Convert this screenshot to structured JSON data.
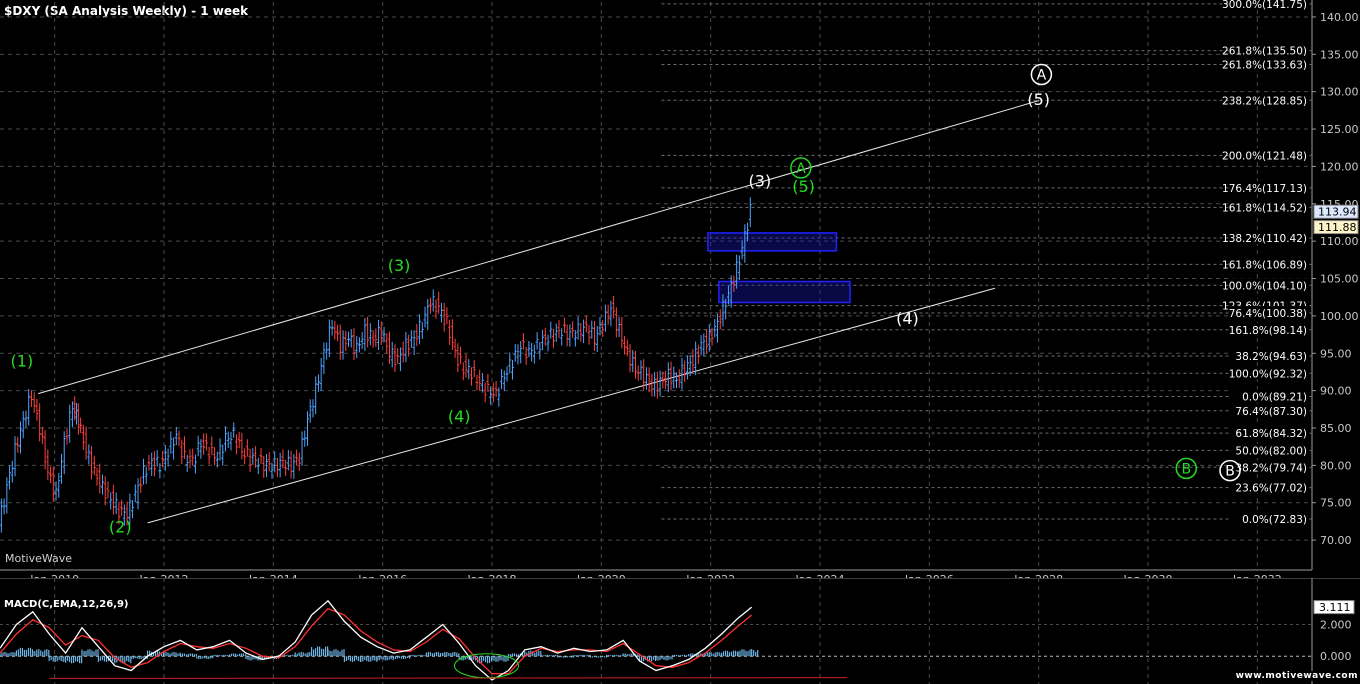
{
  "chart_title": "$DXY (SA Analysis Weekly) - 1 week",
  "watermark": "MotiveWave",
  "footer_url": "www.motivewave.com",
  "colors": {
    "background": "#000000",
    "grid": "#4a4a4a",
    "axis_text": "#c8c8c8",
    "wave_green": "#22dd22",
    "wave_white": "#ffffff",
    "candle_up": "#4fa3ff",
    "candle_down": "#ff4040",
    "box": "#1f22ff",
    "macd_line": "#ffffff",
    "macd_signal": "#ff3030",
    "macd_hist": "#6fb6e6"
  },
  "chart_data": [
    {
      "type": "line",
      "name": "price",
      "ylim": [
        66,
        142
      ],
      "xlim": [
        2009.0,
        2033.0
      ],
      "y_ticks": [
        70,
        75,
        80,
        85,
        90,
        95,
        100,
        105,
        110,
        115,
        120,
        125,
        130,
        135,
        140
      ],
      "y_tick_labels": [
        "70.00",
        "75.00",
        "80.00",
        "85.00",
        "90.00",
        "95.00",
        "100.00",
        "105.00",
        "110.00",
        "115.00",
        "120.00",
        "125.00",
        "130.00",
        "135.00",
        "140.00"
      ],
      "x_ticks": [
        2010,
        2012,
        2014,
        2016,
        2018,
        2020,
        2022,
        2024,
        2026,
        2028,
        2030,
        2032
      ],
      "x_tick_labels": [
        "Jan-2010",
        "Jan-2012",
        "Jan-2014",
        "Jan-2016",
        "Jan-2018",
        "Jan-2020",
        "Jan-2022",
        "Jan-2024",
        "Jan-2026",
        "Jan-2028",
        "Jan-2030",
        "Jan-2032"
      ],
      "x": [
        2009.0,
        2009.15,
        2009.3,
        2009.45,
        2009.6,
        2009.75,
        2009.9,
        2010.05,
        2010.2,
        2010.35,
        2010.45,
        2010.6,
        2010.75,
        2010.9,
        2011.05,
        2011.2,
        2011.35,
        2011.5,
        2011.65,
        2011.8,
        2011.95,
        2012.1,
        2012.25,
        2012.4,
        2012.55,
        2012.7,
        2012.85,
        2013.0,
        2013.15,
        2013.3,
        2013.45,
        2013.6,
        2013.75,
        2013.9,
        2014.05,
        2014.2,
        2014.35,
        2014.5,
        2014.65,
        2014.8,
        2014.95,
        2015.1,
        2015.25,
        2015.4,
        2015.55,
        2015.7,
        2015.85,
        2016.0,
        2016.15,
        2016.3,
        2016.45,
        2016.6,
        2016.75,
        2016.9,
        2017.05,
        2017.2,
        2017.35,
        2017.5,
        2017.65,
        2017.8,
        2017.95,
        2018.1,
        2018.25,
        2018.4,
        2018.55,
        2018.7,
        2018.85,
        2019.0,
        2019.15,
        2019.3,
        2019.45,
        2019.6,
        2019.75,
        2019.9,
        2020.05,
        2020.2,
        2020.35,
        2020.5,
        2020.65,
        2020.8,
        2020.95,
        2021.1,
        2021.25,
        2021.4,
        2021.55,
        2021.7,
        2021.85,
        2022.0,
        2022.15,
        2022.3,
        2022.45,
        2022.6,
        2022.75
      ],
      "y": [
        72,
        77,
        82,
        86,
        89.5,
        85,
        79,
        76,
        83,
        88,
        86,
        82,
        79,
        77,
        75.5,
        74,
        73.5,
        76,
        79,
        80.5,
        80,
        82,
        84,
        81,
        80.5,
        83,
        82,
        81,
        83.5,
        84,
        82,
        81,
        80.5,
        80,
        80,
        80.5,
        80,
        81,
        86,
        90,
        95,
        99,
        96,
        97,
        95.5,
        98,
        97,
        98,
        95,
        94,
        96,
        97,
        99,
        102,
        101,
        99,
        95,
        93,
        92.5,
        91,
        90,
        89.5,
        92,
        94,
        96,
        95,
        96,
        97,
        97.5,
        98,
        97.5,
        98,
        98.5,
        97,
        99,
        101,
        98,
        95,
        93,
        92,
        90.5,
        91,
        92,
        91.5,
        93,
        94,
        96,
        97,
        99,
        102,
        105,
        109,
        114
      ]
    },
    {
      "type": "line",
      "name": "MACD(C,EMA,12,26,9)",
      "ylim": [
        -1.5,
        3.8
      ],
      "y_ticks": [
        0,
        2
      ],
      "y_tick_labels": [
        "0.000",
        "2.000"
      ],
      "last_value": "3.111",
      "x": [
        2009.0,
        2009.3,
        2009.6,
        2009.9,
        2010.2,
        2010.5,
        2010.8,
        2011.1,
        2011.4,
        2011.7,
        2012.0,
        2012.3,
        2012.6,
        2012.9,
        2013.2,
        2013.5,
        2013.8,
        2014.1,
        2014.4,
        2014.7,
        2015.0,
        2015.3,
        2015.6,
        2015.9,
        2016.2,
        2016.5,
        2016.8,
        2017.1,
        2017.4,
        2017.7,
        2018.0,
        2018.3,
        2018.6,
        2018.9,
        2019.2,
        2019.5,
        2019.8,
        2020.1,
        2020.4,
        2020.7,
        2021.0,
        2021.3,
        2021.6,
        2021.9,
        2022.2,
        2022.5,
        2022.75
      ],
      "macd": [
        0.5,
        2.0,
        2.8,
        1.4,
        0.2,
        1.8,
        0.6,
        -0.6,
        -0.9,
        0.0,
        0.6,
        1.0,
        0.4,
        0.6,
        1.0,
        0.2,
        -0.2,
        0.0,
        0.9,
        2.6,
        3.5,
        2.2,
        1.2,
        0.6,
        0.2,
        0.4,
        1.2,
        2.0,
        0.8,
        -0.6,
        -1.5,
        -0.9,
        0.4,
        0.6,
        0.2,
        0.5,
        0.3,
        0.4,
        1.0,
        -0.3,
        -0.9,
        -0.6,
        -0.2,
        0.5,
        1.4,
        2.4,
        3.1
      ],
      "signal": [
        0.2,
        1.4,
        2.3,
        1.8,
        0.7,
        1.3,
        1.0,
        -0.1,
        -0.7,
        -0.4,
        0.3,
        0.8,
        0.6,
        0.5,
        0.8,
        0.5,
        0.0,
        -0.1,
        0.6,
        1.9,
        3.0,
        2.6,
        1.6,
        0.9,
        0.4,
        0.3,
        0.9,
        1.7,
        1.1,
        -0.1,
        -1.1,
        -1.1,
        0.0,
        0.5,
        0.3,
        0.4,
        0.4,
        0.3,
        0.8,
        0.1,
        -0.6,
        -0.7,
        -0.4,
        0.2,
        1.0,
        1.9,
        2.6
      ]
    }
  ],
  "fib_levels": [
    {
      "label": "300.0%(141.75)",
      "value": 141.75
    },
    {
      "label": "261.8%(135.50)",
      "value": 135.5
    },
    {
      "label": "261.8%(133.63)",
      "value": 133.63
    },
    {
      "label": "238.2%(128.85)",
      "value": 128.85
    },
    {
      "label": "200.0%(121.48)",
      "value": 121.48
    },
    {
      "label": "176.4%(117.13)",
      "value": 117.13
    },
    {
      "label": "161.8%(114.52)",
      "value": 114.52
    },
    {
      "label": "138.2%(110.42)",
      "value": 110.42
    },
    {
      "label": "161.8%(106.89)",
      "value": 106.89
    },
    {
      "label": "100.0%(104.10)",
      "value": 104.1
    },
    {
      "label": "123.6%(101.37)",
      "value": 101.37
    },
    {
      "label": "76.4%(100.38)",
      "value": 100.38
    },
    {
      "label": "161.8%(98.14)",
      "value": 98.14
    },
    {
      "label": "38.2%(94.63)",
      "value": 94.63
    },
    {
      "label": "100.0%(92.32)",
      "value": 92.32
    },
    {
      "label": "0.0%(89.21)",
      "value": 89.21
    },
    {
      "label": "76.4%(87.30)",
      "value": 87.3
    },
    {
      "label": "61.8%(84.32)",
      "value": 84.32
    },
    {
      "label": "50.0%(82.00)",
      "value": 82.0
    },
    {
      "label": "38.2%(79.74)",
      "value": 79.74
    },
    {
      "label": "23.6%(77.02)",
      "value": 77.02
    },
    {
      "label": "0.0%(72.83)",
      "value": 72.83
    }
  ],
  "price_tags": [
    {
      "label": "113.94",
      "value": 113.94,
      "bg": "#dce8ff"
    },
    {
      "label": "111.88",
      "value": 111.88,
      "bg": "#fff4c8"
    }
  ],
  "wave_labels": [
    {
      "text": "(1)",
      "x": 2009.4,
      "y": 93.2,
      "color": "green"
    },
    {
      "text": "(2)",
      "x": 2011.2,
      "y": 71.0,
      "color": "green"
    },
    {
      "text": "(3)",
      "x": 2016.3,
      "y": 106.0,
      "color": "green"
    },
    {
      "text": "(4)",
      "x": 2017.4,
      "y": 85.8,
      "color": "green"
    },
    {
      "text": "(5)",
      "x": 2023.7,
      "y": 116.6,
      "color": "green"
    },
    {
      "text": "(3)",
      "x": 2022.9,
      "y": 117.3,
      "color": "white"
    },
    {
      "text": "(4)",
      "x": 2025.6,
      "y": 98.9,
      "color": "white"
    },
    {
      "text": "(5)",
      "x": 2028.0,
      "y": 128.2,
      "color": "white"
    }
  ],
  "circle_labels": [
    {
      "text": "A",
      "x": 2023.65,
      "y": 119.8,
      "color": "green"
    },
    {
      "text": "A",
      "x": 2028.05,
      "y": 132.3,
      "color": "white"
    },
    {
      "text": "B",
      "x": 2030.7,
      "y": 79.6,
      "color": "green"
    },
    {
      "text": "B",
      "x": 2031.5,
      "y": 79.3,
      "color": "white"
    }
  ],
  "channel_lines": [
    {
      "x1": 2009.7,
      "y1": 89.6,
      "x2": 2028.0,
      "y2": 128.8
    },
    {
      "x1": 2011.7,
      "y1": 72.3,
      "x2": 2027.2,
      "y2": 103.7
    }
  ],
  "target_boxes": [
    {
      "x1": 2021.95,
      "x2": 2024.3,
      "y1": 108.7,
      "y2": 111.1
    },
    {
      "x1": 2022.15,
      "x2": 2024.55,
      "y1": 101.8,
      "y2": 104.6
    }
  ]
}
